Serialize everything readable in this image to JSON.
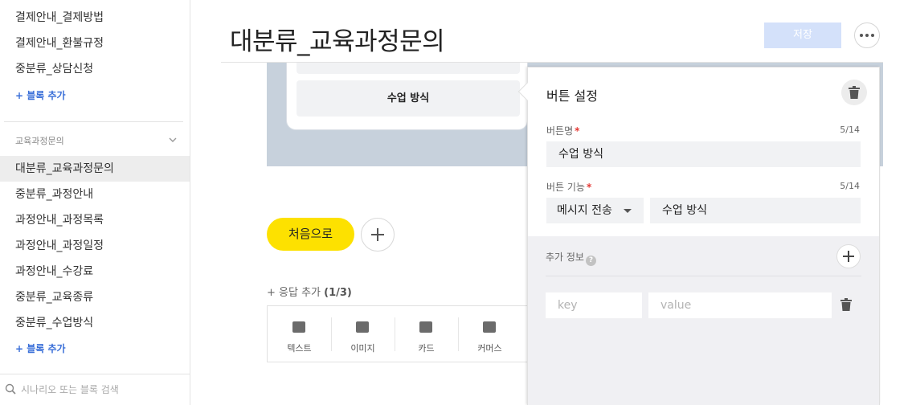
{
  "sidebar": {
    "items_top": [
      {
        "label": "결제안내_결제방법"
      },
      {
        "label": "결제안내_환불규정"
      },
      {
        "label": "중분류_상담신청"
      }
    ],
    "add_block_1": "+ 블록 추가",
    "group_label": "교육과정문의",
    "items_group": [
      {
        "label": "대분류_교육과정문의"
      },
      {
        "label": "중분류_과정안내"
      },
      {
        "label": "과정안내_과정목록"
      },
      {
        "label": "과정안내_과정일정"
      },
      {
        "label": "과정안내_수강료"
      },
      {
        "label": "중분류_교육종류"
      },
      {
        "label": "중분류_수업방식"
      }
    ],
    "add_block_2": "+ 블록 추가",
    "search_placeholder": "시나리오 또는 블록 검색"
  },
  "header": {
    "title": "대분류_교육과정문의",
    "save_label": "저장"
  },
  "preview": {
    "button_label": "수업 방식"
  },
  "canvas": {
    "home_button": "처음으로",
    "response_add": "+ 응답 추가",
    "response_count": "(1/3)",
    "types": [
      {
        "label": "텍스트",
        "icon": "text-icon"
      },
      {
        "label": "이미지",
        "icon": "image-icon"
      },
      {
        "label": "카드",
        "icon": "card-icon"
      },
      {
        "label": "커머스",
        "icon": "commerce-icon"
      }
    ]
  },
  "panel": {
    "title": "버튼 설정",
    "name_label": "버튼명",
    "required_mark": "*",
    "name_count": "5/14",
    "name_value": "수업 방식",
    "func_label": "버튼 기능",
    "func_count": "5/14",
    "func_select": "메시지 전송",
    "func_value": "수업 방식",
    "extra_label": "추가 정보",
    "help_glyph": "?",
    "key_placeholder": "key",
    "value_placeholder": "value"
  },
  "colors": {
    "accent_yellow": "#fde100",
    "link_blue": "#3a6fd8",
    "save_disabled": "#d4e1fa",
    "preview_bg": "#c7d1dc"
  }
}
